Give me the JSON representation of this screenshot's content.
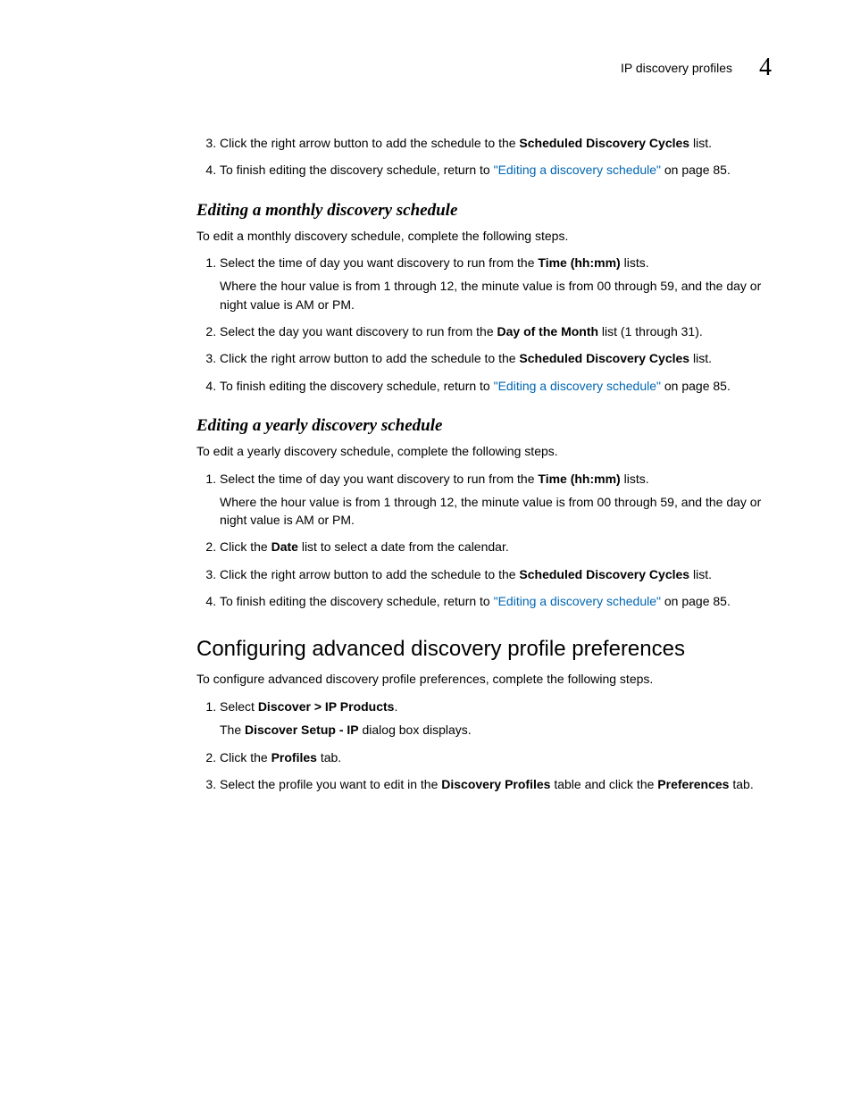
{
  "header": {
    "section_title": "IP discovery profiles",
    "chapter_number": "4"
  },
  "intro_steps": [
    {
      "pre": "Click the right arrow button to add the schedule to the ",
      "bold": "Scheduled Discovery Cycles",
      "post": " list."
    },
    {
      "pre": "To finish editing the discovery schedule, return to ",
      "link": "\"Editing a discovery schedule\"",
      "post": " on page 85."
    }
  ],
  "monthly": {
    "heading": "Editing a monthly discovery schedule",
    "intro": "To edit a monthly discovery schedule, complete the following steps.",
    "steps": [
      {
        "pre": "Select the time of day you want discovery to run from the ",
        "bold": "Time (hh:mm)",
        "post": " lists.",
        "sub": "Where the hour value is from 1 through 12, the minute value is from 00 through 59, and the day or night value is AM or PM."
      },
      {
        "pre": "Select the day you want discovery to run from the ",
        "bold": "Day of the Month",
        "post": " list (1 through 31)."
      },
      {
        "pre": "Click the right arrow button to add the schedule to the ",
        "bold": "Scheduled Discovery Cycles",
        "post": " list."
      },
      {
        "pre": "To finish editing the discovery schedule, return to ",
        "link": "\"Editing a discovery schedule\"",
        "post": " on page 85."
      }
    ]
  },
  "yearly": {
    "heading": "Editing a yearly discovery schedule",
    "intro": "To edit a yearly discovery schedule, complete the following steps.",
    "steps": [
      {
        "pre": "Select the time of day you want discovery to run from the ",
        "bold": "Time (hh:mm)",
        "post": " lists.",
        "sub": "Where the hour value is from 1 through 12, the minute value is from 00 through 59, and the day or night value is AM or PM."
      },
      {
        "pre": "Click the ",
        "bold": "Date",
        "post": " list to select a date from the calendar."
      },
      {
        "pre": "Click the right arrow button to add the schedule to the ",
        "bold": "Scheduled Discovery Cycles",
        "post": " list."
      },
      {
        "pre": "To finish editing the discovery schedule, return to ",
        "link": "\"Editing a discovery schedule\"",
        "post": " on page 85."
      }
    ]
  },
  "advanced": {
    "heading": "Configuring advanced discovery profile preferences",
    "intro": "To configure advanced discovery profile preferences, complete the following steps.",
    "steps": [
      {
        "pre": "Select ",
        "bold": "Discover > IP Products",
        "post": ".",
        "sub_pre": "The ",
        "sub_bold": "Discover Setup - IP",
        "sub_post": " dialog box displays."
      },
      {
        "pre": "Click the ",
        "bold": "Profiles",
        "post": " tab."
      },
      {
        "pre": "Select the profile you want to edit in the ",
        "bold": "Discovery Profiles",
        "mid": " table and click the ",
        "bold2": "Preferences",
        "post": " tab."
      }
    ]
  }
}
